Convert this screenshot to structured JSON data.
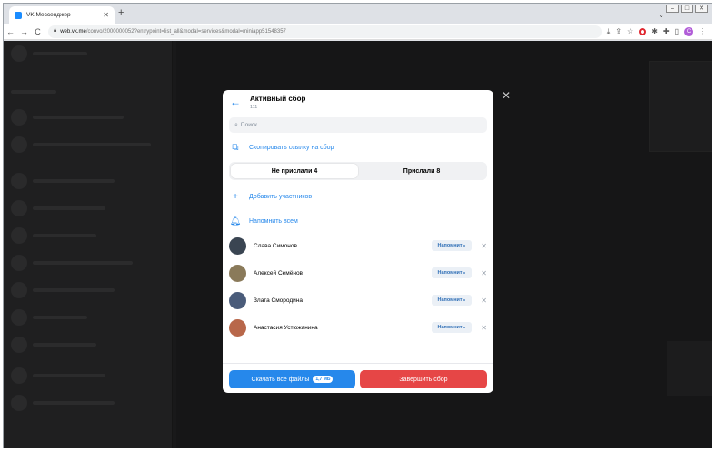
{
  "browser": {
    "tab_title": "VK Мессенджер",
    "tab_close": "✕",
    "new_tab": "+",
    "url_host": "web.vk.me",
    "url_path": "/convo/2000000052?entrypoint=list_all&modal=services&modal=miniapp51548357",
    "profile_initial": "С",
    "back_arrow": "←",
    "forward_arrow": "→",
    "reload": "C",
    "win_min": "–",
    "win_max": "□",
    "win_close": "✕",
    "tab_dropdown": "⌄"
  },
  "modal": {
    "title": "Активный сбор",
    "subtitle": "111",
    "back": "←",
    "close": "✕",
    "search_placeholder": "Поиск",
    "copy_link": "Скопировать ссылку на сбор",
    "tabs": [
      {
        "label": "Не прислали 4",
        "active": true
      },
      {
        "label": "Прислали 8",
        "active": false
      }
    ],
    "add_participants": "Добавить участников",
    "remind_all": "Напомнить всем",
    "remind_label": "Напомнить",
    "remove_glyph": "✕",
    "people": [
      {
        "name": "Слава Симонов",
        "avatar_color": "#3a4552"
      },
      {
        "name": "Алексей Семёнов",
        "avatar_color": "#8a7a5a"
      },
      {
        "name": "Злата Смородина",
        "avatar_color": "#4a5c7a"
      },
      {
        "name": "Анастасия Устюжанина",
        "avatar_color": "#b8674a"
      }
    ],
    "download_all": "Скачать все файлы",
    "download_size": "1,7 МБ",
    "finish": "Завершить сбор"
  },
  "colors": {
    "accent": "#2688eb",
    "danger": "#e64646"
  }
}
